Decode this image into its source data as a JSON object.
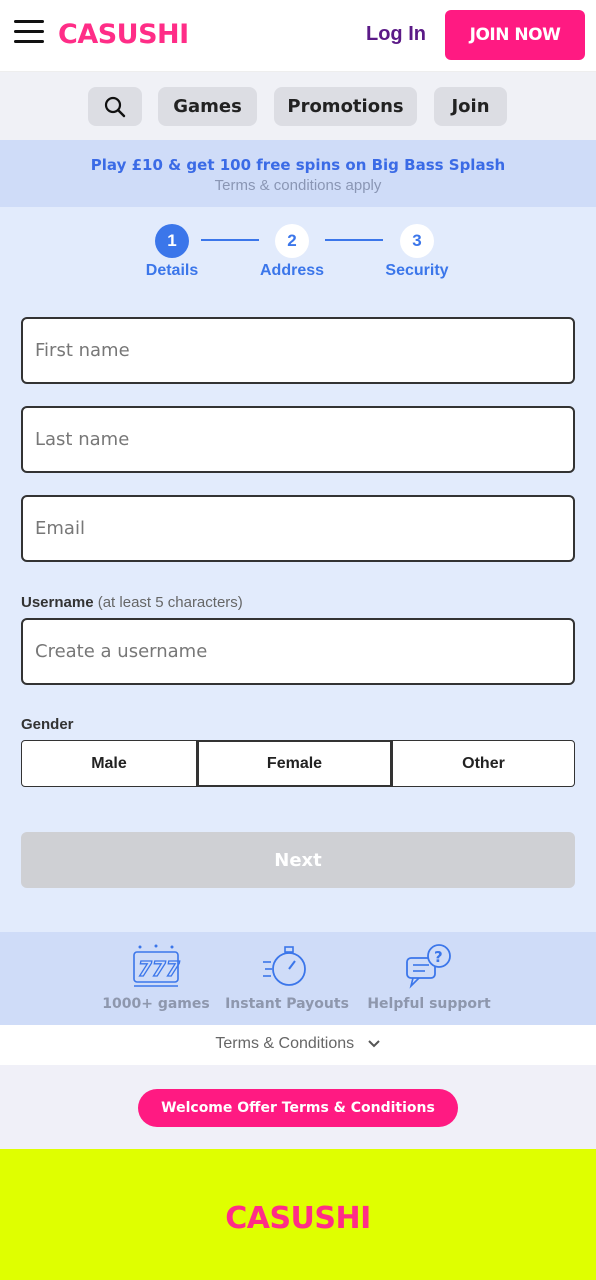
{
  "header": {
    "logo": "CASUSHI",
    "login_label": "Log In",
    "join_label": "JOIN NOW"
  },
  "nav": {
    "items": [
      "Games",
      "Promotions",
      "Join"
    ]
  },
  "promo": {
    "title": "Play £10 & get 100 free spins on Big Bass Splash",
    "subtitle": "Terms & conditions apply"
  },
  "stepper": {
    "steps": [
      {
        "number": "1",
        "label": "Details",
        "active": true
      },
      {
        "number": "2",
        "label": "Address",
        "active": false
      },
      {
        "number": "3",
        "label": "Security",
        "active": false
      }
    ]
  },
  "form": {
    "first_name_placeholder": "First name",
    "last_name_placeholder": "Last name",
    "email_placeholder": "Email",
    "username_label": "Username",
    "username_hint": "(at least 5 characters)",
    "username_placeholder": "Create a username",
    "gender_label": "Gender",
    "gender_options": [
      "Male",
      "Female",
      "Other"
    ],
    "gender_selected": "Female",
    "next_label": "Next"
  },
  "features": [
    {
      "label": "1000+ games",
      "icon": "slot-777-icon"
    },
    {
      "label": "Instant Payouts",
      "icon": "stopwatch-icon"
    },
    {
      "label": "Helpful support",
      "icon": "chat-question-icon"
    }
  ],
  "terms": {
    "link_label": "Terms & Conditions",
    "welcome_offer_label": "Welcome Offer Terms & Conditions"
  },
  "footer": {
    "logo": "CASUSHI"
  },
  "colors": {
    "brand_pink": "#ff1a82",
    "accent_blue": "#3b76ea",
    "footer_lime": "#dfff00"
  }
}
